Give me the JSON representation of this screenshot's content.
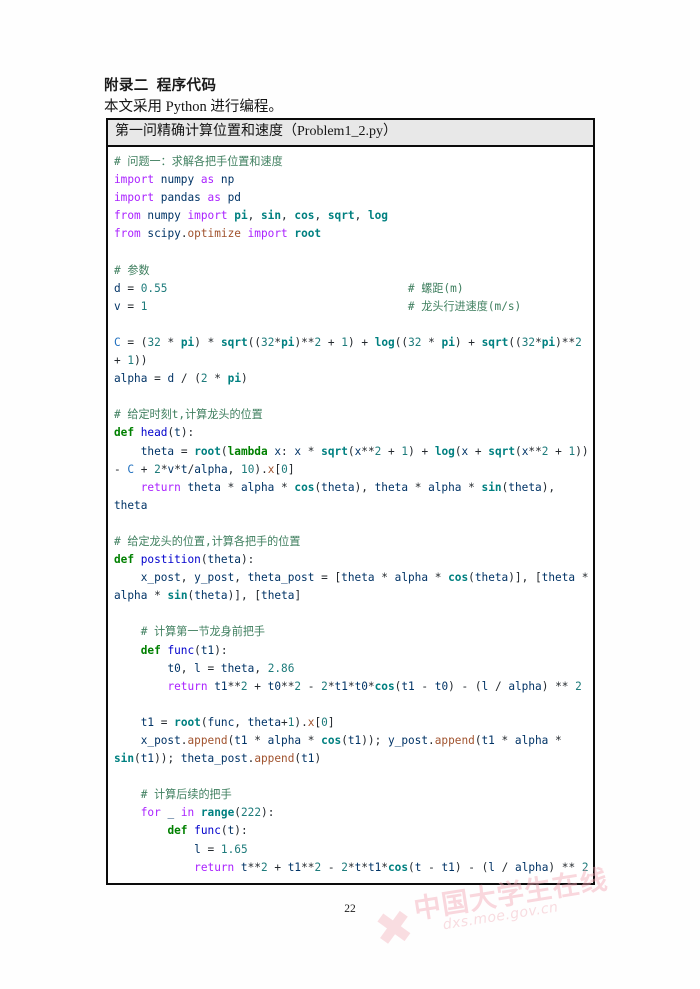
{
  "document": {
    "appendix_title": "附录二  程序代码",
    "intro_line": "本文采用 Python 进行编程。",
    "page_number": "22"
  },
  "code_block": {
    "caption": "第一问精确计算位置和速度（Problem1_2.py）",
    "language": "python",
    "lines": [
      "# 问题一：求解各把手位置和速度",
      "import numpy as np",
      "import pandas as pd",
      "from numpy import pi, sin, cos, sqrt, log",
      "from scipy.optimize import root",
      "",
      "# 参数",
      "d = 0.55                                    # 螺距(m)",
      "v = 1                                       # 龙头行进速度(m/s)",
      "",
      "C = (32 * pi) * sqrt((32*pi)**2 + 1) + log((32 * pi) + sqrt((32*pi)**2 + 1))",
      "alpha = d / (2 * pi)",
      "",
      "# 给定时刻t,计算龙头的位置",
      "def head(t):",
      "    theta = root(lambda x: x * sqrt(x**2 + 1) + log(x + sqrt(x**2 + 1)) - C + 2*v*t/alpha, 10).x[0]",
      "    return theta * alpha * cos(theta), theta * alpha * sin(theta), theta",
      "",
      "# 给定龙头的位置,计算各把手的位置",
      "def postition(theta):",
      "    x_post, y_post, theta_post = [theta * alpha * cos(theta)], [theta * alpha * sin(theta)], [theta]",
      "",
      "    # 计算第一节龙身前把手",
      "    def func(t1):",
      "        t0, l = theta, 2.86",
      "        return t1**2 + t0**2 - 2*t1*t0*cos(t1 - t0) - (l / alpha) ** 2",
      "",
      "    t1 = root(func, theta+1).x[0]",
      "    x_post.append(t1 * alpha * cos(t1)); y_post.append(t1 * alpha * sin(t1)); theta_post.append(t1)",
      "",
      "    # 计算后续的把手",
      "    for _ in range(222):",
      "        def func(t):",
      "            l = 1.65",
      "            return t**2 + t1**2 - 2*t*t1*cos(t - t1) - (l / alpha) ** 2"
    ]
  },
  "watermark": {
    "star_glyph": "✖",
    "text_cn": "中国大学生在线",
    "text_url": "dxs.moe.gov.cn"
  },
  "colors": {
    "comment": "#3f7f5f",
    "keyword": "#aa22ff",
    "builtin": "#008080",
    "number": "#1e7b7b",
    "function": "#0000cc",
    "identifier": "#003366",
    "attribute": "#a0522d",
    "border": "#0b0b0b",
    "caption_bg": "#e8e8e8",
    "watermark_pink": "#f3a9b6"
  }
}
